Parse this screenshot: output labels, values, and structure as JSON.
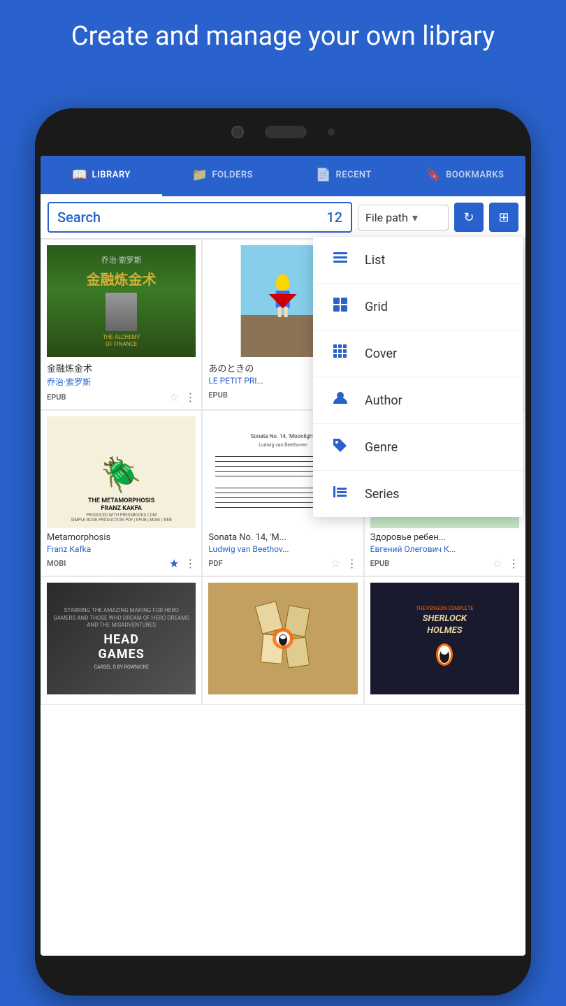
{
  "header": {
    "title": "Create and manage your own library"
  },
  "tabs": [
    {
      "id": "library",
      "label": "LIBRARY",
      "active": true,
      "icon": "📖"
    },
    {
      "id": "folders",
      "label": "FOLDERS",
      "active": false,
      "icon": "📁"
    },
    {
      "id": "recent",
      "label": "RECENT",
      "active": false,
      "icon": "📄"
    },
    {
      "id": "bookmarks",
      "label": "BOOKMARKS",
      "active": false,
      "icon": "🔖"
    }
  ],
  "toolbar": {
    "search_placeholder": "Search",
    "search_count": "12",
    "sort_label": "File path",
    "refresh_icon": "↻",
    "grid_icon": "⊞"
  },
  "books": [
    {
      "title": "金融炼金术",
      "author": "乔治·索罗斯",
      "format": "EPUB",
      "starred": false,
      "cover_type": "alchemy"
    },
    {
      "title": "あのときの",
      "author": "LE PETIT PRI...",
      "format": "EPUB",
      "starred": false,
      "cover_type": "little_prince"
    },
    {
      "title": "Metamorphosis",
      "author": "Franz Kafka",
      "format": "MOBI",
      "starred": true,
      "cover_type": "metamorphosis"
    },
    {
      "title": "Sonata No. 14, 'M...",
      "author": "Ludwig van Beethov...",
      "format": "PDF",
      "starred": false,
      "cover_type": "sonata"
    },
    {
      "title": "Здоровье ребен...",
      "author": "Евгений Олегович К...",
      "format": "EPUB",
      "starred": false,
      "cover_type": "health"
    },
    {
      "title": "Head Games",
      "author": "",
      "format": "",
      "starred": false,
      "cover_type": "head"
    },
    {
      "title": "",
      "author": "",
      "format": "",
      "starred": false,
      "cover_type": "tiles"
    },
    {
      "title": "Sherlock Holmes",
      "author": "",
      "format": "",
      "starred": false,
      "cover_type": "sherlock"
    }
  ],
  "dropdown": {
    "items": [
      {
        "id": "list",
        "label": "List",
        "icon": "list"
      },
      {
        "id": "grid",
        "label": "Grid",
        "icon": "grid4"
      },
      {
        "id": "cover",
        "label": "Cover",
        "icon": "grid9"
      },
      {
        "id": "author",
        "label": "Author",
        "icon": "person"
      },
      {
        "id": "genre",
        "label": "Genre",
        "icon": "tag"
      },
      {
        "id": "series",
        "label": "Series",
        "icon": "series"
      }
    ]
  },
  "colors": {
    "primary": "#2962CC",
    "accent": "#2962CC"
  }
}
